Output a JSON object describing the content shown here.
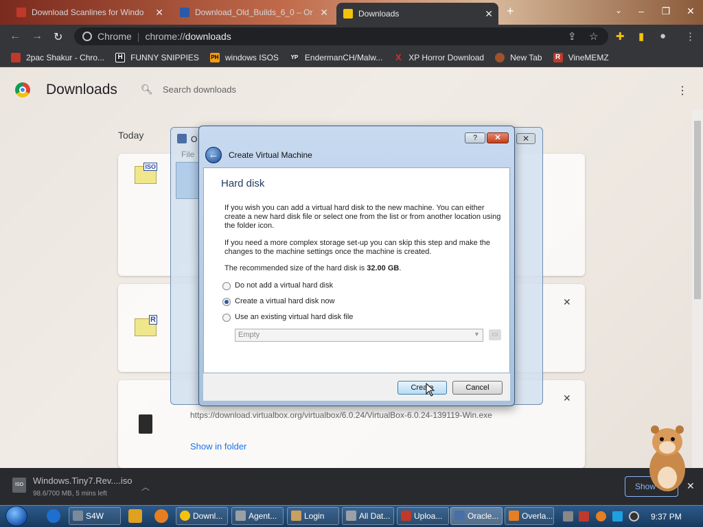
{
  "browser": {
    "tabs": [
      {
        "title": "Download Scanlines for Windo",
        "fav": "#c0392b"
      },
      {
        "title": "Download_Old_Builds_6_0 – Or",
        "fav": "#2a5aa8"
      },
      {
        "title": "Downloads",
        "fav": "#f4c20d",
        "active": true
      }
    ],
    "omnibox_site": "Chrome",
    "omnibox_scheme": "chrome://",
    "omnibox_path": "downloads",
    "bookmarks": [
      {
        "label": "2pac Shakur - Chro...",
        "icon": "image-bookmark-icon",
        "icon_text": "",
        "color": "#c0392b"
      },
      {
        "label": "FUNNY SNIPPIES",
        "icon": "h-bookmark-icon",
        "icon_text": "H",
        "color": "#202124"
      },
      {
        "label": "windows ISOS",
        "icon": "ph-bookmark-icon",
        "icon_text": "PH",
        "color": "#f39c12"
      },
      {
        "label": "EndermanCH/Malw...",
        "icon": "yp-bookmark-icon",
        "icon_text": "YP",
        "color": "#333333"
      },
      {
        "label": "XP Horror Download",
        "icon": "x-bookmark-icon",
        "icon_text": "X",
        "color": "#d93025"
      },
      {
        "label": "New Tab",
        "icon": "globe-bookmark-icon",
        "icon_text": "",
        "color": "#a0522d"
      },
      {
        "label": "VineMEMZ",
        "icon": "r-bookmark-icon",
        "icon_text": "R",
        "color": "#c0392b"
      }
    ]
  },
  "downloads_page": {
    "title": "Downloads",
    "search_placeholder": "Search downloads",
    "section": "Today",
    "item_iso_label": "ISO",
    "item_r_label": "R",
    "item3_url": "https://download.virtualbox.org/virtualbox/6.0.24/VirtualBox-6.0.24-139119-Win.exe",
    "item3_action": "Show in folder"
  },
  "shelf": {
    "icon_text": "ISO",
    "filename": "Windows.Tiny7.Rev....iso",
    "status": "98.6/700 MB, 5 mins left",
    "show_all": "Show"
  },
  "vbox_manager": {
    "title_fragment": "O",
    "menu_fragment": "File"
  },
  "dialog": {
    "window_title": "Create Virtual Machine",
    "heading": "Hard disk",
    "para1": "If you wish you can add a virtual hard disk to the new machine. You can either create a new hard disk file or select one from the list or from another location using the folder icon.",
    "para2": "If you need a more complex storage set-up you can skip this step and make the changes to the machine settings once the machine is created.",
    "recommended_prefix": "The recommended size of the hard disk is ",
    "recommended_size": "32.00 GB",
    "recommended_suffix": ".",
    "options": [
      "Do not add a virtual hard disk",
      "Create a virtual hard disk now",
      "Use an existing virtual hard disk file"
    ],
    "selected_option": 1,
    "combo_value": "Empty",
    "create_label": "Create",
    "cancel_label": "Cancel",
    "help_label": "?",
    "close_label": "✕"
  },
  "taskbar": {
    "items": [
      {
        "label": "S4W",
        "color": "#7a8a9a"
      },
      {
        "label": "Downl...",
        "color": "#f4c20d"
      },
      {
        "label": "Agent...",
        "color": "#9aa0a6"
      },
      {
        "label": "Login",
        "color": "#c8a060"
      },
      {
        "label": "All Dat...",
        "color": "#9aa0a6"
      },
      {
        "label": "Uploa...",
        "color": "#c0392b"
      },
      {
        "label": "Oracle...",
        "color": "#4a6fa5"
      },
      {
        "label": "Overla...",
        "color": "#e67e22"
      }
    ],
    "clock": "9:37 PM"
  }
}
